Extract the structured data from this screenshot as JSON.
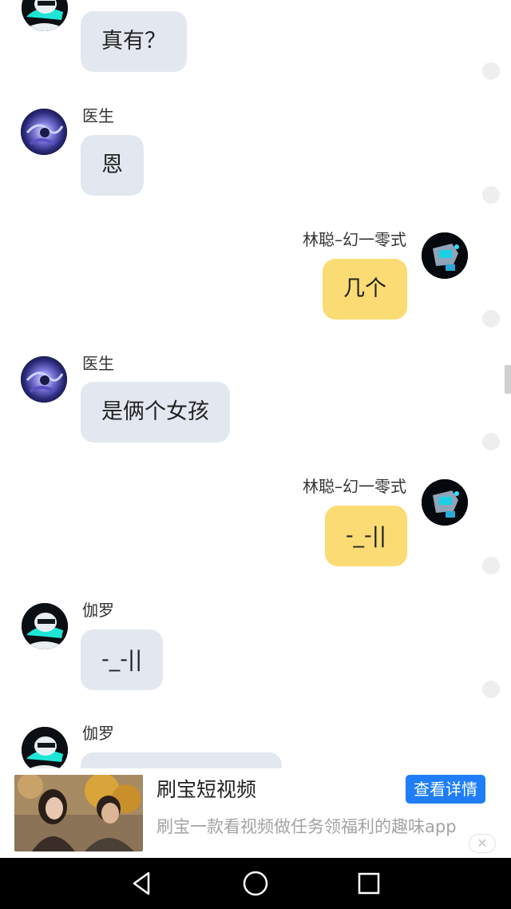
{
  "chat": {
    "messages": [
      {
        "side": "left",
        "sender": "",
        "text": "真有？",
        "avatar": "robot-cyan-avatar"
      },
      {
        "side": "left",
        "sender": "医生",
        "text": "恩",
        "avatar": "galaxy-purple-avatar"
      },
      {
        "side": "right",
        "sender": "林聪–幻一零式",
        "text": "几个",
        "avatar": "robot-dark-avatar"
      },
      {
        "side": "left",
        "sender": "医生",
        "text": "是俩个女孩",
        "avatar": "galaxy-purple-avatar"
      },
      {
        "side": "right",
        "sender": "林聪–幻一零式",
        "text": "-_-||",
        "avatar": "robot-dark-avatar"
      },
      {
        "side": "left",
        "sender": "伽罗",
        "text": "-_-||",
        "avatar": "robot-cyan-avatar"
      },
      {
        "side": "left",
        "sender": "伽罗",
        "text": "",
        "avatar": "robot-cyan-avatar"
      }
    ]
  },
  "ad": {
    "title": "刷宝短视频",
    "description": "刷宝一款看视频做任务领福利的趣味app",
    "button_label": "查看详情",
    "close_glyph": "✕"
  },
  "colors": {
    "left_bubble": "#e3e8f0",
    "right_bubble": "#fbdc74",
    "ad_button": "#1f7ef7",
    "nav_bar": "#000000"
  },
  "navbar": {
    "icons": [
      "back-triangle-icon",
      "home-circle-icon",
      "recents-square-icon"
    ]
  }
}
